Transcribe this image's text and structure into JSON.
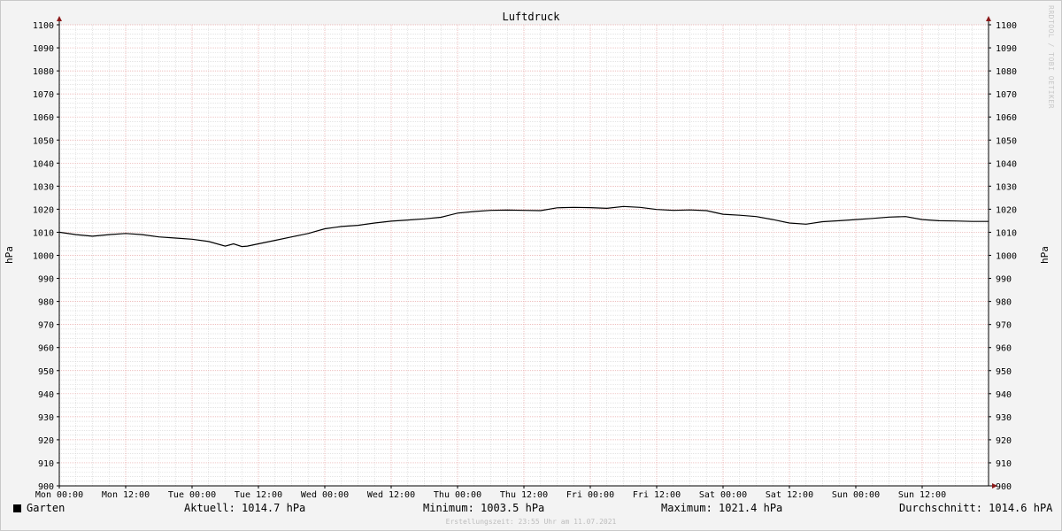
{
  "chart_data": {
    "type": "line",
    "title": "Luftdruck",
    "ylabel": "hPa",
    "ylim": [
      900,
      1100
    ],
    "y_ticks": [
      900,
      910,
      920,
      930,
      940,
      950,
      960,
      970,
      980,
      990,
      1000,
      1010,
      1020,
      1030,
      1040,
      1050,
      1060,
      1070,
      1080,
      1090,
      1100
    ],
    "x_tick_labels": [
      "Mon 00:00",
      "Mon 12:00",
      "Tue 00:00",
      "Tue 12:00",
      "Wed 00:00",
      "Wed 12:00",
      "Thu 00:00",
      "Thu 12:00",
      "Fri 00:00",
      "Fri 12:00",
      "Sat 00:00",
      "Sat 12:00",
      "Sun 00:00",
      "Sun 12:00"
    ],
    "x_range_hours": [
      0,
      168
    ],
    "grid": true,
    "series": [
      {
        "name": "Garten",
        "color": "#000000",
        "x_hours": [
          0,
          3,
          6,
          9,
          12,
          15,
          18,
          21,
          24,
          27,
          30,
          31.5,
          33,
          34,
          36,
          39,
          42,
          45,
          48,
          51,
          54,
          57,
          60,
          63,
          66,
          69,
          72,
          75,
          78,
          81,
          84,
          87,
          90,
          93,
          96,
          99,
          102,
          105,
          108,
          111,
          114,
          117,
          120,
          123,
          126,
          129,
          132,
          135,
          138,
          141,
          144,
          147,
          150,
          153,
          156,
          159,
          162,
          165,
          168
        ],
        "values": [
          1010,
          1009,
          1008.3,
          1009,
          1009.5,
          1009,
          1008,
          1007.5,
          1007,
          1006,
          1004,
          1005,
          1003.8,
          1004,
          1005,
          1006.5,
          1008,
          1009.5,
          1011.5,
          1012.5,
          1013,
          1014,
          1014.8,
          1015.3,
          1015.8,
          1016.5,
          1018.3,
          1019,
          1019.5,
          1019.6,
          1019.5,
          1019.4,
          1020.6,
          1020.8,
          1020.7,
          1020.4,
          1021.2,
          1020.8,
          1019.9,
          1019.5,
          1019.7,
          1019.4,
          1017.8,
          1017.4,
          1016.8,
          1015.5,
          1014,
          1013.5,
          1014.6,
          1015,
          1015.5,
          1016,
          1016.6,
          1016.8,
          1015.5,
          1015,
          1014.9,
          1014.7,
          1014.7
        ]
      }
    ]
  },
  "legend": {
    "series_name": "Garten",
    "current": "Aktuell: 1014.7 hPa",
    "minimum": "Minimum: 1003.5 hPa",
    "maximum": "Maximum: 1021.4 hPa",
    "average": "Durchschnitt: 1014.6 hPA"
  },
  "footer": "Erstellungszeit: 23:55 Uhr am 11.07.2021",
  "watermark": "RRDTOOL / TOBI OETIKER"
}
